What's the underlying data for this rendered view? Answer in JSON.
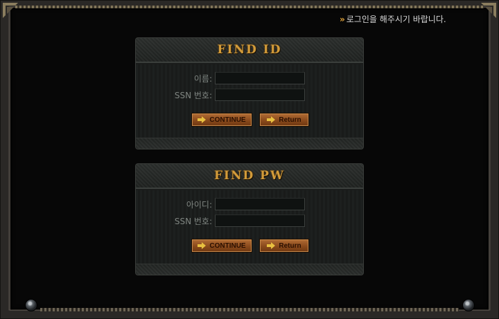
{
  "notice": {
    "marker": "»",
    "text": "로그인을 해주시기 바랍니다."
  },
  "find_id": {
    "title": "FIND ID",
    "fields": [
      {
        "label": "이름:",
        "value": ""
      },
      {
        "label": "SSN 번호:",
        "value": ""
      }
    ],
    "continue_label": "CONTINUE",
    "return_label": "Return"
  },
  "find_pw": {
    "title": "FIND PW",
    "fields": [
      {
        "label": "아이디:",
        "value": ""
      },
      {
        "label": "SSN 번호:",
        "value": ""
      }
    ],
    "continue_label": "CONTINUE",
    "return_label": "Return"
  },
  "colors": {
    "title_gold": "#d29b3a",
    "button_bronze": "#8a4a1c",
    "arrow_yellow": "#e8c040"
  },
  "icons": {
    "arrow": "arrow-right-icon",
    "bolt": "bolt-icon",
    "corner": "corner-ornament-icon"
  }
}
